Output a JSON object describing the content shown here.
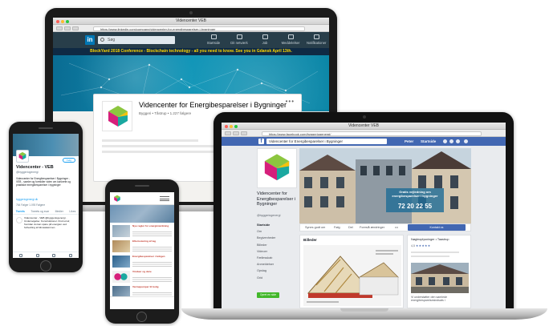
{
  "linkedin": {
    "window_title": "Videncenter VEB",
    "url": "https://www.linkedin.com/company/videncenter-for-energibesparelser-i-bygninger",
    "logo_text": "in",
    "search_placeholder": "Søg",
    "nav_items": [
      "Startside",
      "Dit netværk",
      "Job",
      "Meddelelser",
      "Notifikationer"
    ],
    "banner": "BlockYard 2018 Conference - Blockchain technology - all you need to know. See you in Gdansk April 13th.",
    "company_name": "Videncenter for Energibesparelser i Bygninger",
    "company_sub": "Byggeri  •  Tåstrup  •  1.227 følgere",
    "more_label": "•••"
  },
  "facebook": {
    "window_title": "Videncenter VEB",
    "url": "https://www.facebook.com/byggeriogenergi/",
    "logo_text": "f",
    "search_value": "Videncenter for Energibesparelser i Bygninger",
    "nav_user": "Peter",
    "nav_home": "Startside",
    "page_name": "Videncenter for Energibesparelser i Bygninger",
    "page_handle": "@byggeriogenergi",
    "menu": [
      "Startside",
      "Om",
      "Begivenheder",
      "Billeder",
      "Videoer",
      "Fællesskab",
      "Anmeldelser",
      "Opslag",
      "Grid"
    ],
    "create_page": "Opret en side",
    "cover_text": "Gratis vejledning om energibesparelser i bygninger",
    "cover_phone": "72 20 22 55",
    "actions": [
      "Synes godt om",
      "Følg",
      "Del",
      "Foreslå ændringer",
      "•••"
    ],
    "blue_button": "Kontakt os",
    "photos_title": "Billeder",
    "right_title": "Nøgleoplysninger • Taastrup",
    "rating": "4,5",
    "stars": "★★★★★",
    "right_text": "Vi understøtter den samlede energibesparelsesindsats i"
  },
  "twitter": {
    "follow": "Følg",
    "name": "Videncenter - VEB",
    "handle": "@byggeriogenergi",
    "bio": "Videncenter for Energibesparelser i Bygninger - VEB - samler og formidler viden om konkrete og praktiske energibesparelser i bygninger",
    "link": "byggeriogenergi.dk",
    "stats": "764 Følger   1.093 Følgere",
    "tabs": [
      "Tweets",
      "Tweets og svar",
      "Medier",
      "Likes"
    ],
    "tweet": "Videncenter - VEB @byggeriogenergi · Undersøgelse: Konstruktioner. Find ud af, hvordan du kan spare på energien ved forbedring af klimaskærmen."
  },
  "website": {
    "rows": [
      {
        "title": "Nye regler for energimærkning"
      },
      {
        "title": "Efterisolering af tag"
      },
      {
        "title": "Energibesparelser i boligen"
      },
      {
        "title": "Vinduer og døre"
      },
      {
        "title": "Varmepumper til bolig"
      }
    ]
  },
  "colors": {
    "linkedin_nav": "#283e4a",
    "linkedin_brand": "#0077b5",
    "facebook_brand": "#4267b2",
    "twitter_brand": "#1da1f2",
    "veb_green": "#8cc63f",
    "veb_magenta": "#d61f7b",
    "veb_teal": "#1aa8a0"
  }
}
